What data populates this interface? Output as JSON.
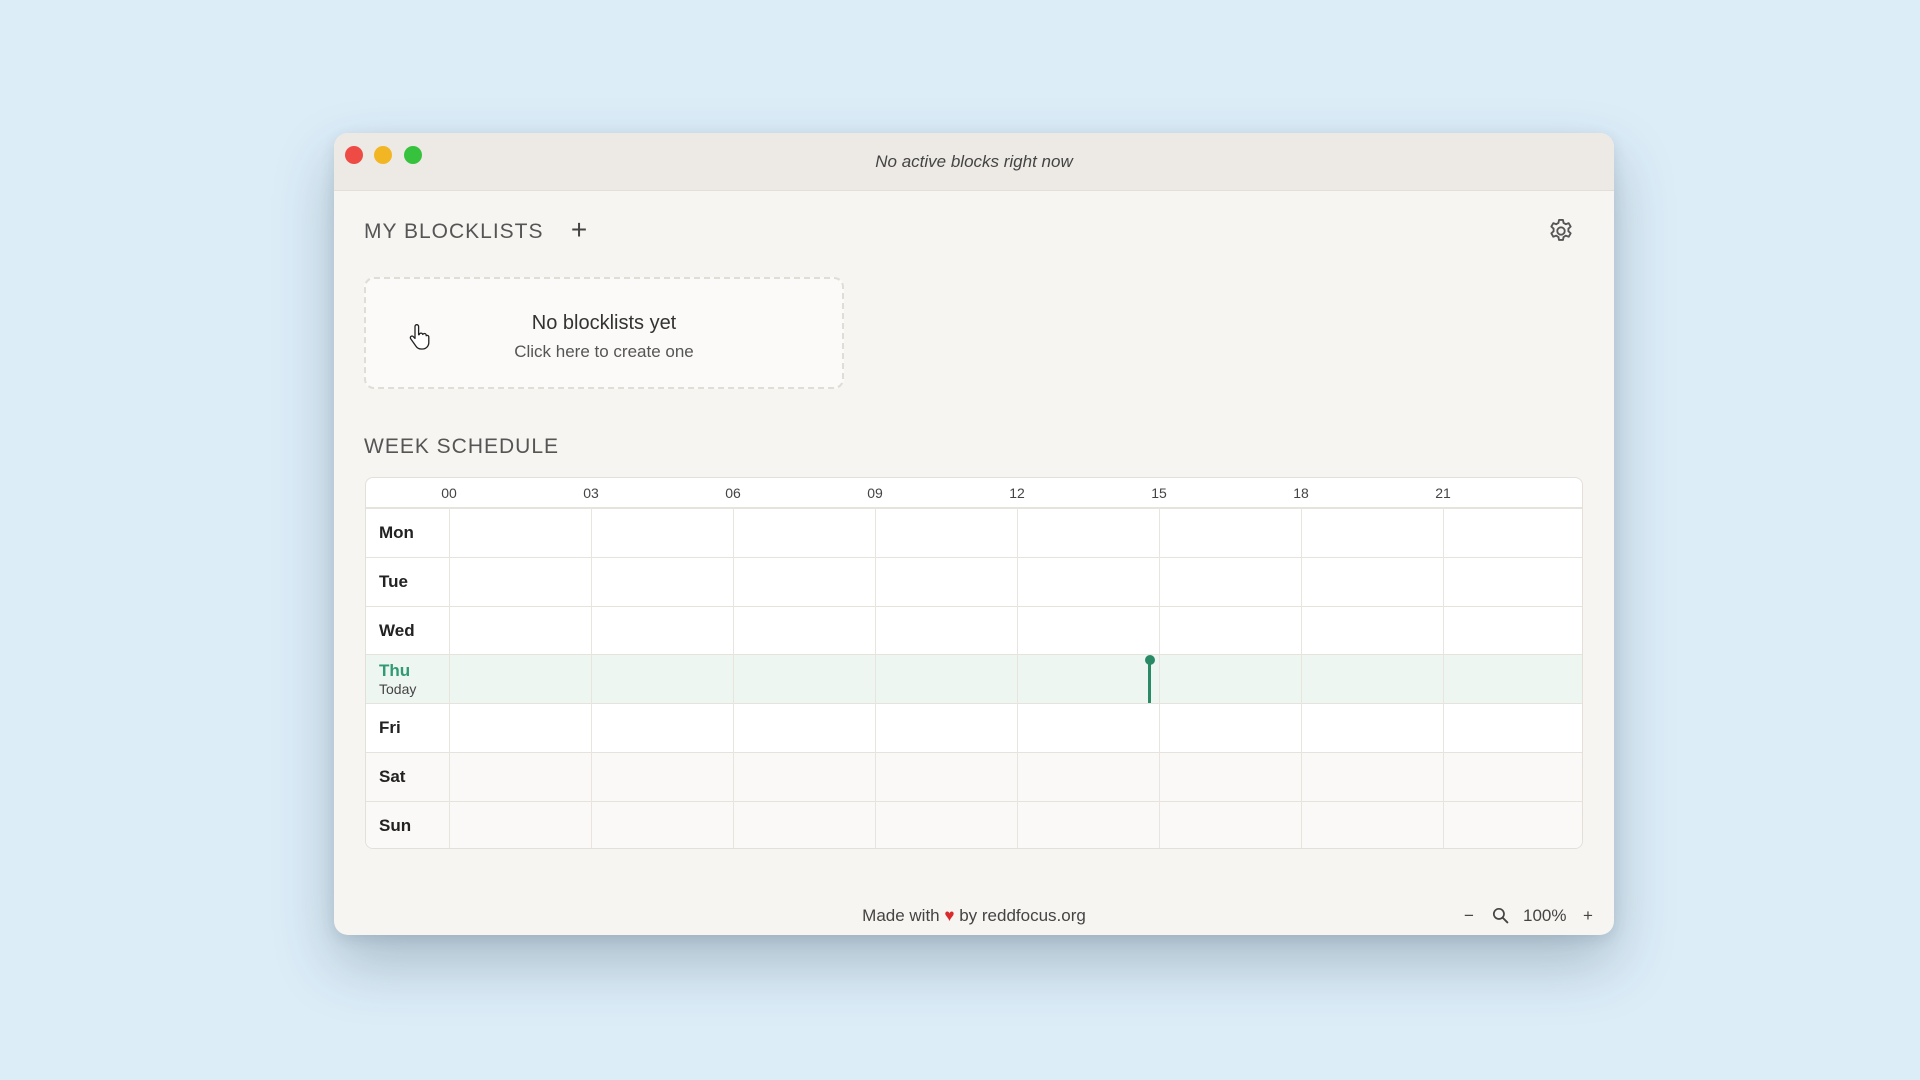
{
  "window": {
    "title": "No active blocks right now"
  },
  "blocklists": {
    "heading": "MY BLOCKLISTS",
    "add_label": "+",
    "empty_title": "No blocklists yet",
    "empty_subtitle": "Click here to create one"
  },
  "schedule": {
    "heading": "WEEK SCHEDULE",
    "hours": [
      "00",
      "03",
      "06",
      "09",
      "12",
      "15",
      "18",
      "21"
    ],
    "days": [
      {
        "name": "Mon",
        "sub": "",
        "today": false,
        "weekend": false
      },
      {
        "name": "Tue",
        "sub": "",
        "today": false,
        "weekend": false
      },
      {
        "name": "Wed",
        "sub": "",
        "today": false,
        "weekend": false
      },
      {
        "name": "Thu",
        "sub": "Today",
        "today": true,
        "weekend": false
      },
      {
        "name": "Fri",
        "sub": "",
        "today": false,
        "weekend": false
      },
      {
        "name": "Sat",
        "sub": "",
        "today": false,
        "weekend": true
      },
      {
        "name": "Sun",
        "sub": "",
        "today": false,
        "weekend": true
      }
    ],
    "current_time_hours": 14.8
  },
  "footer": {
    "prefix": "Made with",
    "heart": "♥",
    "suffix": "by reddfocus.org"
  },
  "zoom": {
    "minus_label": "−",
    "level": "100%",
    "plus_label": "+"
  },
  "colors": {
    "accent": "#2a8a66",
    "today_text": "#2f9a74",
    "heart": "#d92b2b"
  },
  "icons": {
    "settings": "gear-icon",
    "zoom": "magnifier-icon",
    "cursor": "hand-pointer-icon"
  }
}
